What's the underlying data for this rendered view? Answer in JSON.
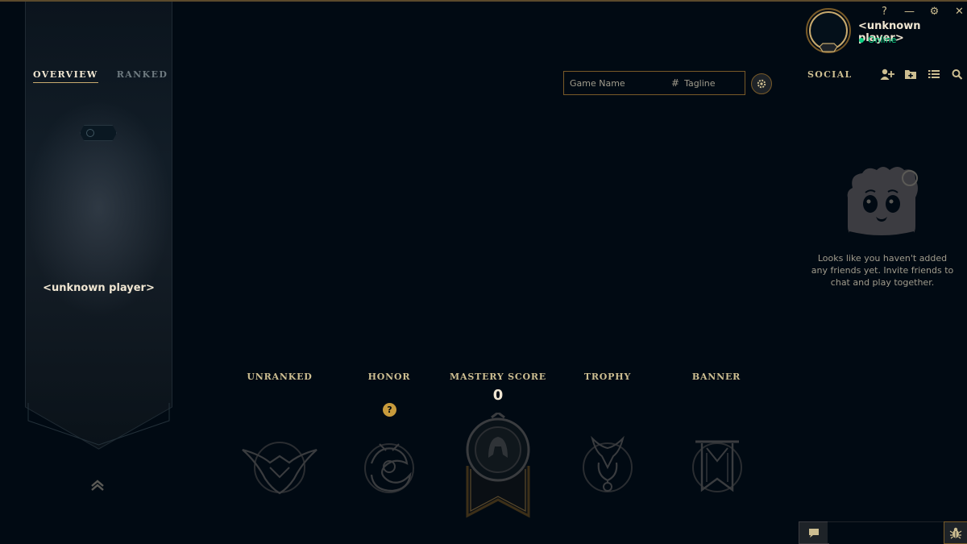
{
  "profile": {
    "tabs": [
      {
        "label": "OVERVIEW",
        "active": true
      },
      {
        "label": "RANKED",
        "active": false
      }
    ],
    "banner_name": "<unknown player>"
  },
  "riot_id_search": {
    "game_name_placeholder": "Game Name",
    "tagline_placeholder": "Tagline",
    "hash_symbol": "#"
  },
  "header": {
    "player_name": "<unknown player>",
    "status": "Online",
    "window_controls": [
      "?",
      "—",
      "⚙",
      "✕"
    ]
  },
  "social": {
    "title": "SOCIAL",
    "icons": [
      "add-friend-icon",
      "add-folder-icon",
      "list-view-icon",
      "search-icon"
    ],
    "empty_message": "Looks like you haven't added any friends yet. Invite friends to chat and play together."
  },
  "stats": {
    "unranked_label": "UNRANKED",
    "honor_label": "HONOR",
    "honor_help": "?",
    "mastery_label": "MASTERY SCORE",
    "mastery_value": "0",
    "trophy_label": "TROPHY",
    "banner_label": "BANNER"
  },
  "colors": {
    "background": "#010a13",
    "gold": "#c89b3c",
    "gold_text": "#cdbe91",
    "online": "#0acf83"
  }
}
